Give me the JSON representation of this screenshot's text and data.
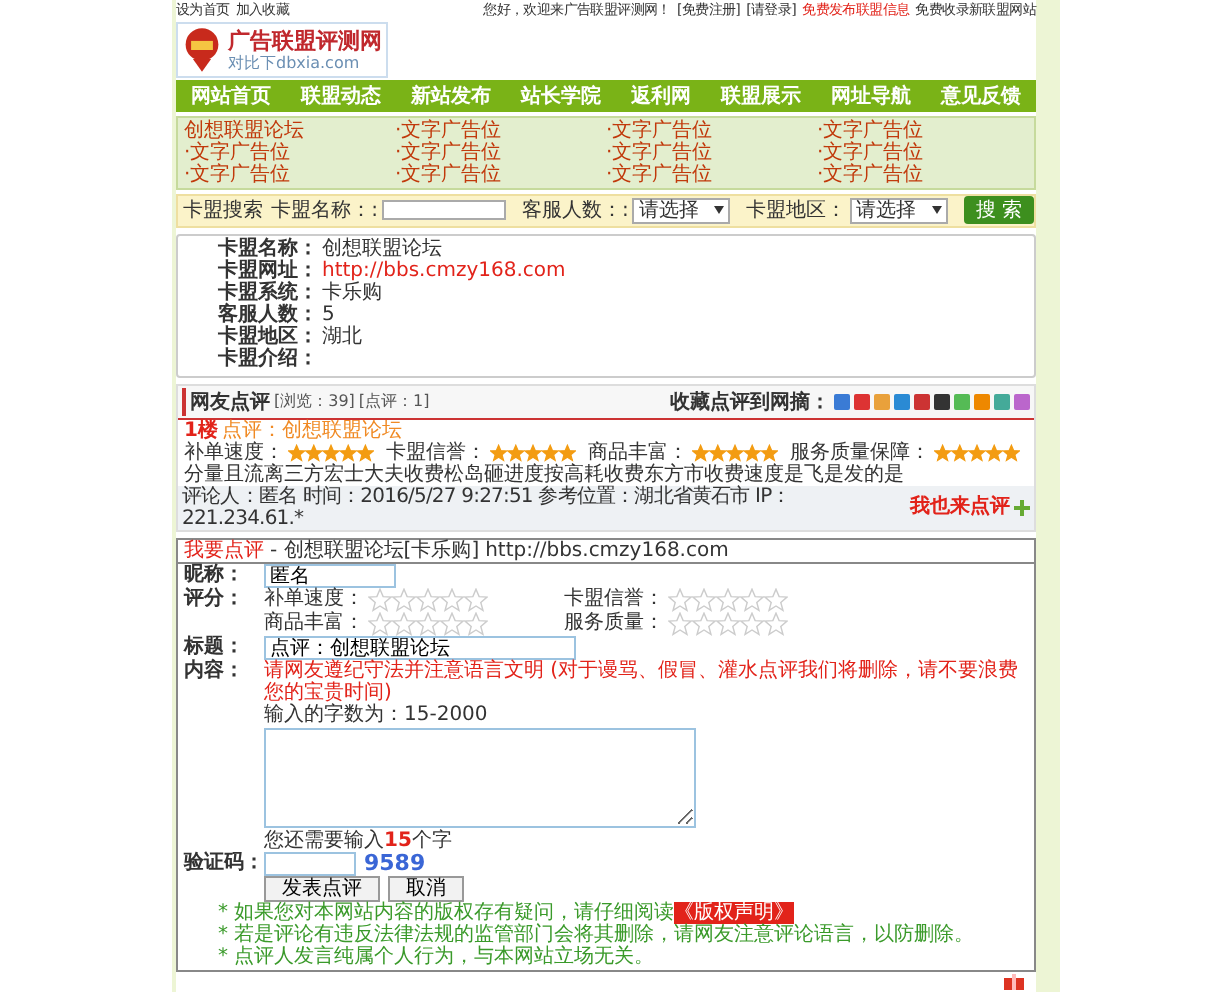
{
  "top_bar": {
    "left": [
      "设为首页",
      "加入收藏"
    ],
    "greeting": "您好，欢迎来广告联盟评测网！",
    "links": [
      "[免费注册]",
      "[请登录]"
    ],
    "promo": "免费发布联盟信息",
    "promo_2": "免费收录新联盟网站"
  },
  "logo": {
    "title": "广告联盟评测网",
    "subtitle": "对比下dbxia.com"
  },
  "nav": [
    {
      "label": "网站首页"
    },
    {
      "label": "联盟动态"
    },
    {
      "label": "新站发布"
    },
    {
      "label": "站长学院"
    },
    {
      "label": "返利网"
    },
    {
      "label": "联盟展示"
    },
    {
      "label": "网址导航"
    },
    {
      "label": "意见反馈"
    }
  ],
  "ads": [
    "创想联盟论坛",
    "·文字广告位",
    "·文字广告位",
    "·文字广告位",
    "·文字广告位",
    "·文字广告位",
    "·文字广告位",
    "·文字广告位",
    "·文字广告位",
    "·文字广告位",
    "·文字广告位",
    "·文字广告位"
  ],
  "search": {
    "title": "卡盟搜索",
    "name_label": "卡盟名称：:",
    "staff_label": "客服人数：:",
    "staff_value": "请选择",
    "region_label": "卡盟地区：",
    "region_value": "请选择",
    "button": "搜 索"
  },
  "info": [
    {
      "label": "卡盟名称：",
      "value": "创想联盟论坛",
      "kind": "text"
    },
    {
      "label": "卡盟网址：",
      "value": "http://bbs.cmzy168.com",
      "kind": "link"
    },
    {
      "label": "卡盟系统：",
      "value": "卡乐购",
      "kind": "text"
    },
    {
      "label": "客服人数：",
      "value": "5",
      "kind": "text"
    },
    {
      "label": "卡盟地区：",
      "value": "湖北",
      "kind": "text"
    },
    {
      "label": "卡盟介绍："
    }
  ],
  "reviews": {
    "title": "网友点评",
    "views": "[浏览：39]",
    "count": "[点评：1]",
    "share_label": "收藏点评到网摘：",
    "items": [
      {
        "floor": "1楼",
        "title": "点评：创想联盟论坛",
        "ratings": [
          {
            "label": "补单速度：",
            "stars": 5
          },
          {
            "label": "卡盟信誉：",
            "stars": 5
          },
          {
            "label": "商品丰富：",
            "stars": 5
          },
          {
            "label": "服务质量保障：",
            "stars": 5
          }
        ],
        "text": "分量且流离三方宏士大夫收费松岛砸进度按高耗收费东方市收费速度是飞是发的是",
        "meta": "评论人：匿名  时间：2016/5/27 9:27:51  参考位置：湖北省黄石市  IP：221.234.61.*",
        "reply": "我也来点评"
      }
    ]
  },
  "form": {
    "title": "我要点评",
    "subject": "- 创想联盟论坛[卡乐购]",
    "url": "http://bbs.cmzy168.com",
    "nickname_label": "昵称：",
    "nickname": "匿名",
    "score_label": "评分：",
    "ratings": [
      {
        "label": "补单速度：",
        "stars": 0
      },
      {
        "label": "卡盟信誉：",
        "stars": 0
      },
      {
        "label": "商品丰富：",
        "stars": 0
      },
      {
        "label": "服务质量：",
        "stars": 0
      }
    ],
    "title_label": "标题：",
    "title_value": "点评：创想联盟论坛",
    "content_label": "内容：",
    "notice": "请网友遵纪守法并注意语言文明 (对于谩骂、假冒、灌水点评我们将删除，请不要浪费您的宝贵时间)",
    "length_hint": "输入的字数为：15-2000",
    "remaining_before": "您还需要输入",
    "remaining": "15",
    "remaining_after": "个字",
    "captcha_label": "验证码：",
    "captcha": "9589",
    "submit": "发表点评",
    "cancel": "取消",
    "notes": [
      "* 如果您对本网站内容的版权存有疑问，请仔细阅读",
      "* 若是评论有违反法律法规的监管部门会将其删除，请网友注意评论语言，以防删除。",
      "* 点评人发言纯属个人行为，与本网站立场无关。"
    ],
    "notes_link": "《版权声明》"
  }
}
